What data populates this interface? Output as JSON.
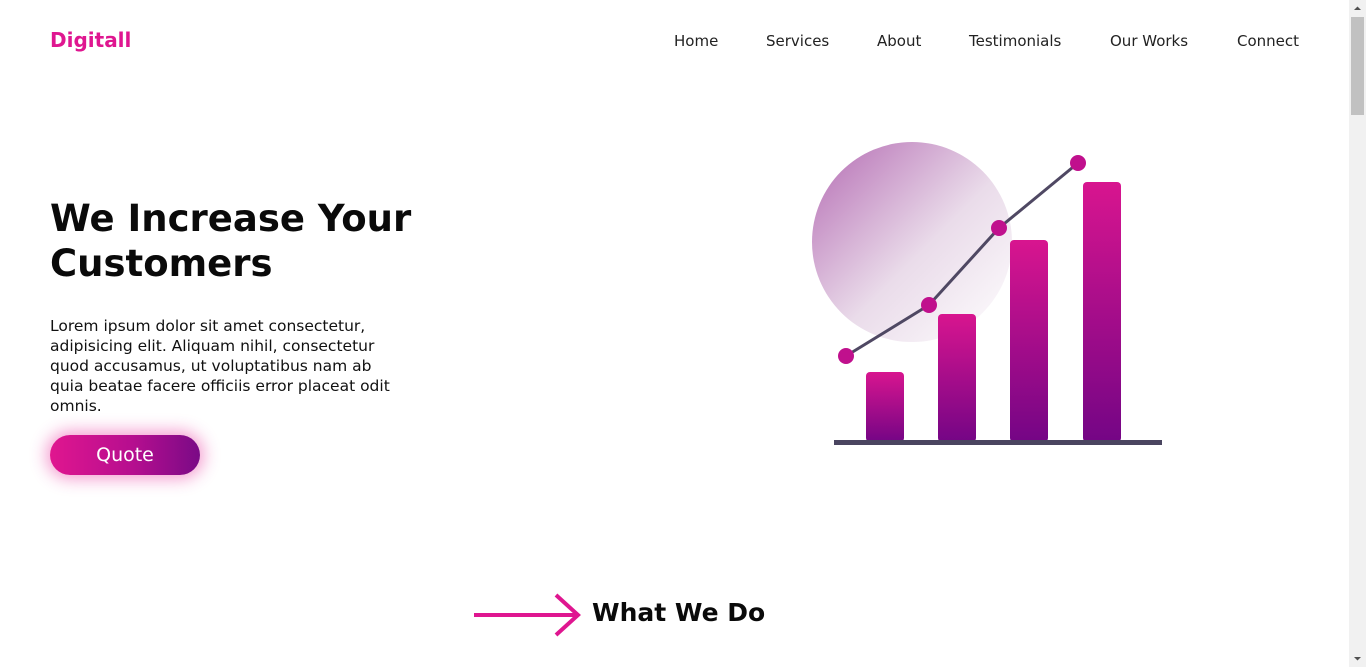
{
  "brand": {
    "name": "Digitall",
    "color": "#df1690"
  },
  "nav": {
    "items": [
      "Home",
      "Services",
      "About",
      "Testimonials",
      "Our Works",
      "Connect"
    ]
  },
  "hero": {
    "title": "We Increase Your Customers",
    "description": "Lorem ipsum dolor sit amet consectetur, adipisicing elit. Aliquam nihil, consectetur quod accusamus, ut voluptatibus nam ab quia beatae facere officiis error placeat odit omnis.",
    "cta_label": "Quote",
    "illustration_icon": "growth-bar-chart-icon"
  },
  "section": {
    "title": "What We Do",
    "icon": "arrow-right-icon"
  },
  "colors": {
    "accent": "#df1690",
    "accent_dark": "#7a0a86",
    "line": "#4f4863"
  }
}
